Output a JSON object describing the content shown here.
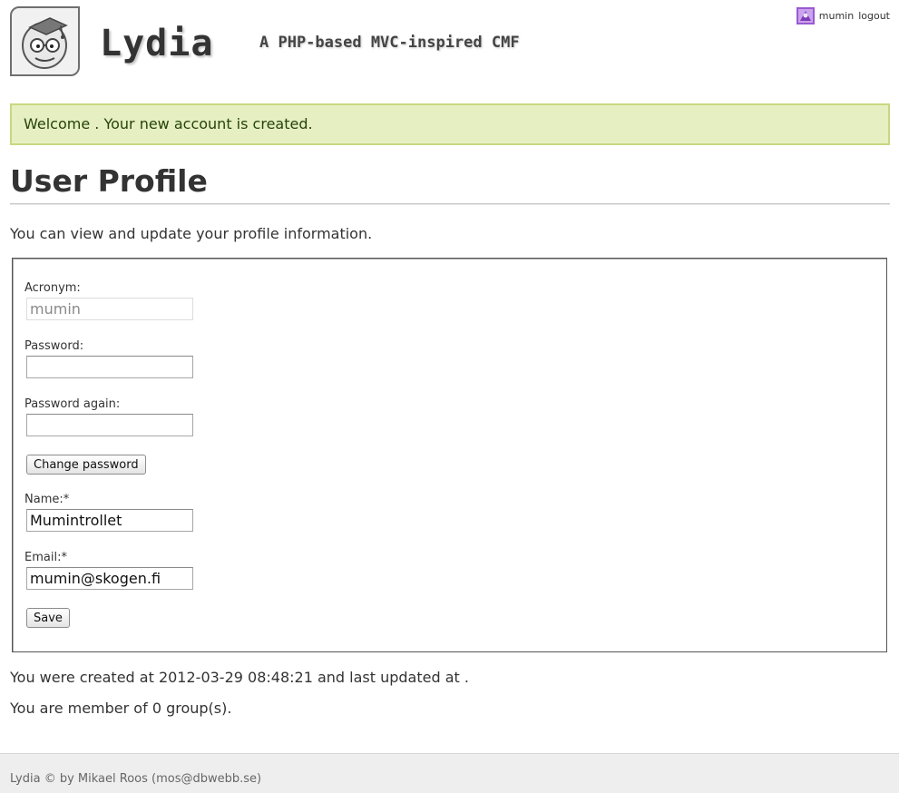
{
  "header": {
    "site_title": "Lydia",
    "slogan": "A PHP-based MVC-inspired CMF",
    "logo_icon": "lydia-face-logo",
    "login_menu": {
      "avatar_icon": "gravatar-icon",
      "username": "mumin",
      "logout_label": "logout"
    }
  },
  "flash": {
    "message": "Welcome . Your new account is created.",
    "background": "#e6efc2",
    "border": "#c6d880",
    "text_color": "#264409"
  },
  "main": {
    "title": "User Profile",
    "intro": "You can view and update your profile information.",
    "form": {
      "acronym_label": "Acronym:",
      "acronym_value": "mumin",
      "password_label": "Password:",
      "password_value": "",
      "password_again_label": "Password again:",
      "password_again_value": "",
      "change_password_label": "Change password",
      "name_label": "Name:*",
      "name_value": "Mumintrollet",
      "email_label": "Email:*",
      "email_value": "mumin@skogen.fi",
      "save_label": "Save"
    },
    "created_text": "You were created at 2012-03-29 08:48:21 and last updated at .",
    "groups_text": "You are member of 0 group(s)."
  },
  "footer": {
    "text": "Lydia © by Mikael Roos (mos@dbwebb.se)"
  }
}
